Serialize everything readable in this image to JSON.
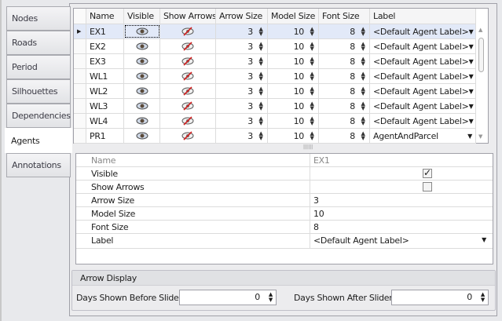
{
  "tabs": [
    "Nodes",
    "Roads",
    "Period",
    "Silhouettes",
    "Dependencies",
    "Agents",
    "Annotations"
  ],
  "selected_tab": "Agents",
  "grid": {
    "columns": [
      "Name",
      "Visible",
      "Show Arrows",
      "Arrow Size",
      "Model Size",
      "Font Size",
      "Label"
    ],
    "rows": [
      {
        "name": "EX1",
        "arrow_size": "3",
        "model_size": "10",
        "font_size": "8",
        "label": "<Default Agent Label>"
      },
      {
        "name": "EX2",
        "arrow_size": "3",
        "model_size": "10",
        "font_size": "8",
        "label": "<Default Agent Label>"
      },
      {
        "name": "EX3",
        "arrow_size": "3",
        "model_size": "10",
        "font_size": "8",
        "label": "<Default Agent Label>"
      },
      {
        "name": "WL1",
        "arrow_size": "3",
        "model_size": "10",
        "font_size": "8",
        "label": "<Default Agent Label>"
      },
      {
        "name": "WL2",
        "arrow_size": "3",
        "model_size": "10",
        "font_size": "8",
        "label": "<Default Agent Label>"
      },
      {
        "name": "WL3",
        "arrow_size": "3",
        "model_size": "10",
        "font_size": "8",
        "label": "<Default Agent Label>"
      },
      {
        "name": "WL4",
        "arrow_size": "3",
        "model_size": "10",
        "font_size": "8",
        "label": "<Default Agent Label>"
      },
      {
        "name": "PR1",
        "arrow_size": "3",
        "model_size": "10",
        "font_size": "8",
        "label": "AgentAndParcel"
      }
    ]
  },
  "properties": {
    "name": {
      "label": "Name",
      "value": "EX1"
    },
    "visible": {
      "label": "Visible",
      "checked": true
    },
    "show_arrows": {
      "label": "Show Arrows",
      "checked": false
    },
    "arrow_size": {
      "label": "Arrow Size",
      "value": "3"
    },
    "model_size": {
      "label": "Model Size",
      "value": "10"
    },
    "font_size": {
      "label": "Font Size",
      "value": "8"
    },
    "label": {
      "label": "Label",
      "value": "<Default Agent Label>"
    }
  },
  "arrow_display": {
    "title": "Arrow Display",
    "before_label": "Days Shown Before Slider:",
    "before_value": "0",
    "after_label": "Days Shown After Slider:",
    "after_value": "0"
  }
}
